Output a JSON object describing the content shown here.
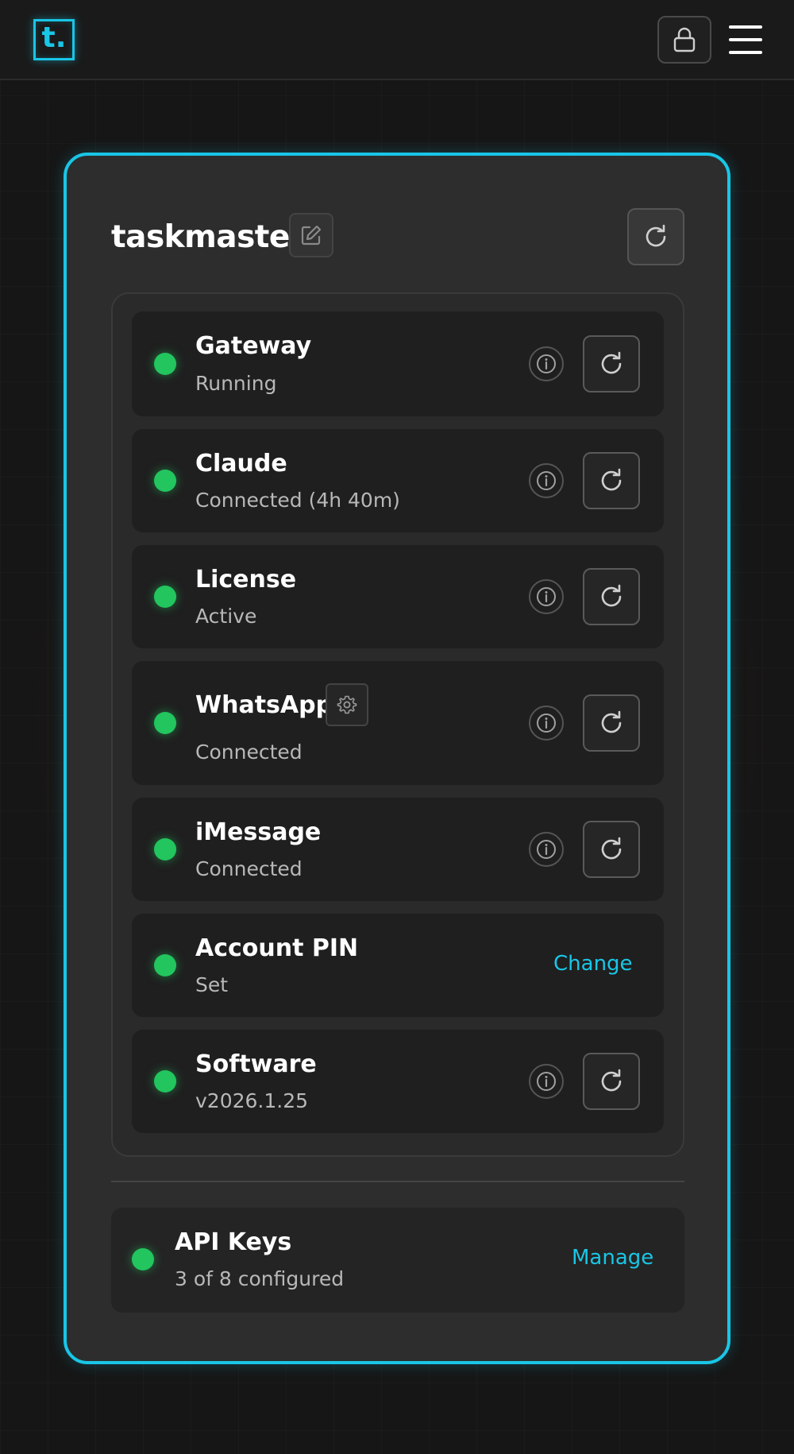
{
  "header": {
    "logo_text": "t.",
    "accent_color": "#19c6e6"
  },
  "card": {
    "title": "taskmaster"
  },
  "services": [
    {
      "name": "Gateway",
      "status": "Running",
      "status_color": "#22c55e"
    },
    {
      "name": "Claude",
      "status": "Connected (4h 40m)",
      "status_color": "#22c55e"
    },
    {
      "name": "License",
      "status": "Active",
      "status_color": "#22c55e"
    },
    {
      "name": "WhatsApp",
      "status": "Connected",
      "status_color": "#22c55e"
    },
    {
      "name": "iMessage",
      "status": "Connected",
      "status_color": "#22c55e"
    },
    {
      "name": "Account PIN",
      "status": "Set",
      "status_color": "#22c55e",
      "action_label": "Change"
    },
    {
      "name": "Software",
      "status": "v2026.1.25",
      "status_color": "#22c55e"
    }
  ],
  "api_keys": {
    "name": "API Keys",
    "status": "3 of 8 configured",
    "action_label": "Manage",
    "status_color": "#22c55e"
  }
}
